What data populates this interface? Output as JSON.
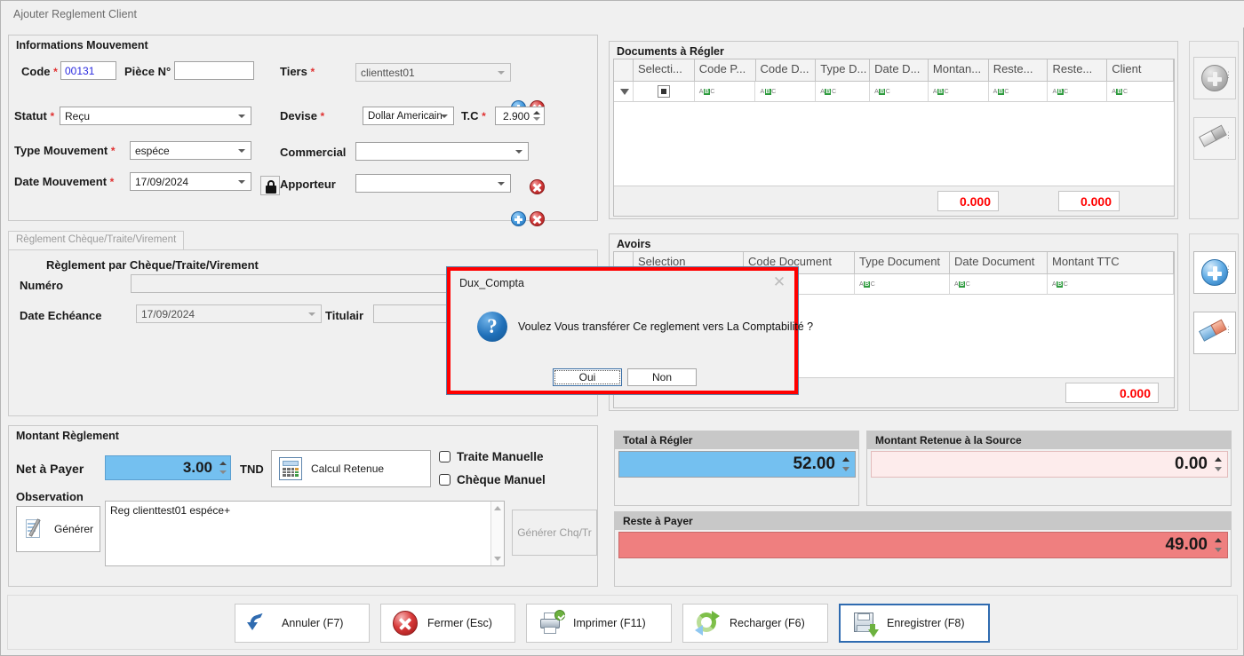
{
  "window": {
    "title": "Ajouter Reglement Client"
  },
  "movement": {
    "group_title": "Informations Mouvement",
    "code_label": "Code",
    "code_value": "00131",
    "piece_label": "Pièce N°",
    "piece_value": "",
    "statut_label": "Statut",
    "statut_value": "Reçu",
    "type_label": "Type Mouvement",
    "type_value": "espéce",
    "date_label": "Date Mouvement",
    "date_value": "17/09/2024",
    "tiers_label": "Tiers",
    "tiers_value": "clienttest01",
    "devise_label": "Devise",
    "devise_value": "Dollar Americain",
    "tc_label": "T.C",
    "tc_value": "2.900",
    "commercial_label": "Commercial",
    "commercial_value": "",
    "apporteur_label": "Apporteur",
    "apporteur_value": ""
  },
  "cheque": {
    "tab_label": "Règlement Chèque/Traite/Virement",
    "heading": "Règlement par Chèque/Traite/Virement",
    "numero_label": "Numéro",
    "numero_value": "",
    "echeance_label": "Date Echéance",
    "echeance_value": "17/09/2024",
    "titulair_label": "Titulair",
    "titulair_value": ""
  },
  "documents": {
    "group_title": "Documents à Régler",
    "columns": [
      "Selecti...",
      "Code P...",
      "Code D...",
      "Type D...",
      "Date D...",
      "Montan...",
      "Reste...",
      "Reste...",
      "Client"
    ],
    "filter_row": [
      "",
      "ABC",
      "ABC",
      "ABC",
      "ABC",
      "ABC",
      "ABC",
      "ABC",
      "ABC"
    ],
    "rows": [],
    "total_1": "0.000",
    "total_2": "0.000"
  },
  "avoirs": {
    "group_title": "Avoirs",
    "columns": [
      "Selection",
      "Code Document",
      "Type Document",
      "Date Document",
      "Montant TTC"
    ],
    "rows": [],
    "total": "0.000"
  },
  "side_buttons": {
    "documents_add": "add-icon",
    "documents_erase": "eraser-icon",
    "avoirs_add": "add-icon",
    "avoirs_erase": "eraser-icon"
  },
  "amount": {
    "group_title": "Montant Règlement",
    "net_label": "Net à Payer",
    "net_value": "3.00",
    "currency": "TND",
    "calc_label": "Calcul Retenue",
    "traite_manuelle": "Traite Manuelle",
    "cheque_manuel": "Chèque Manuel",
    "observation_label": "Observation",
    "generer_label": "Générer",
    "observation_value": "Reg clienttest01 espéce+",
    "generer_chq_label": "Générer Chq/Tr"
  },
  "totals": {
    "total_regler_label": "Total à Régler",
    "total_regler_value": "52.00",
    "retenue_label": "Montant Retenue à la Source",
    "retenue_value": "0.00",
    "reste_label": "Reste à Payer",
    "reste_value": "49.00"
  },
  "toolbar": {
    "annuler": "Annuler (F7)",
    "fermer": "Fermer (Esc)",
    "imprimer": "Imprimer (F11)",
    "recharger": "Recharger (F6)",
    "enregistrer": "Enregistrer (F8)"
  },
  "dialog": {
    "title": "Dux_Compta",
    "message": "Voulez Vous  transférer Ce reglement vers La Comptabilité ?",
    "yes": "Oui",
    "no": "Non",
    "close_icon": "close-icon"
  },
  "colors": {
    "required": "#e03131",
    "accent_blue": "#74c0f0",
    "danger_red": "#ef7f7f",
    "pink": "#fdecec",
    "total_red": "#ff0000",
    "dialog_border": "#ff0000"
  }
}
